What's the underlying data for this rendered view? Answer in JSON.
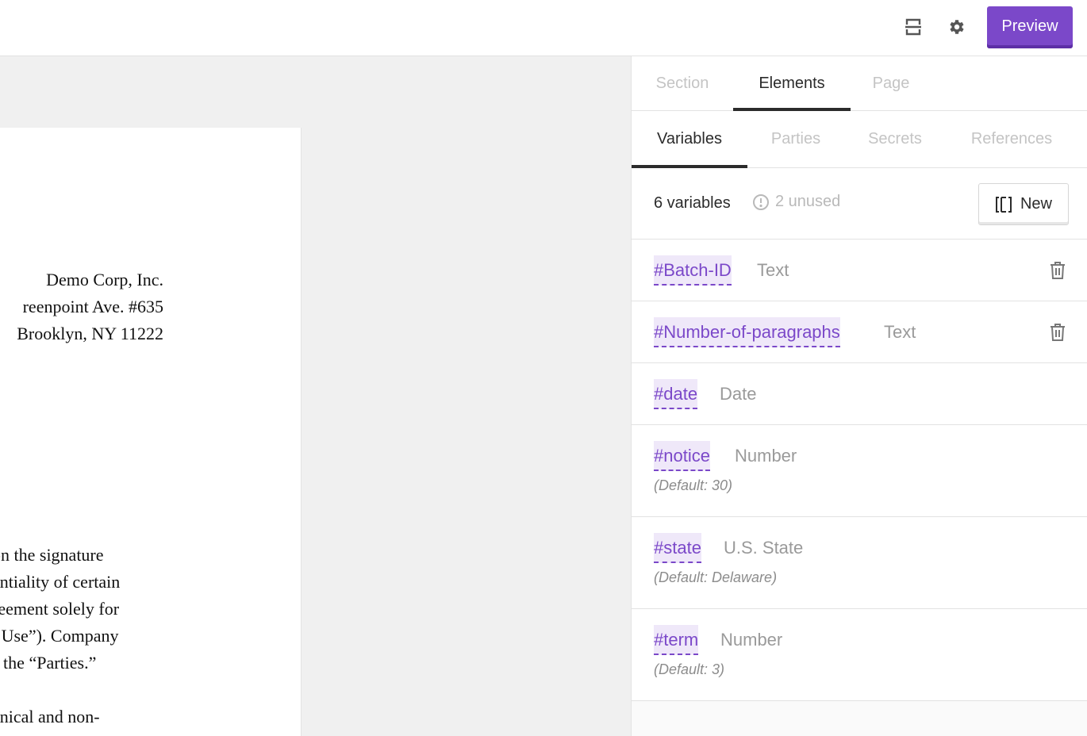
{
  "toolbar": {
    "print_icon": "page-break-icon",
    "settings_icon": "gear-icon",
    "preview_label": "Preview"
  },
  "document": {
    "address": [
      "Demo Corp, Inc.",
      "reenpoint Ave. #635",
      "Brooklyn, NY 11222"
    ],
    "body_lines": [
      " on the signature",
      "entiality of certain",
      "reement solely for",
      "l Use”). Company",
      "s the “Parties.”"
    ],
    "body_lines_2": [
      "anical and non-"
    ]
  },
  "panel": {
    "main_tabs": [
      {
        "label": "Section",
        "active": false
      },
      {
        "label": "Elements",
        "active": true
      },
      {
        "label": "Page",
        "active": false
      }
    ],
    "sub_tabs": [
      {
        "label": "Variables",
        "active": true
      },
      {
        "label": "Parties",
        "active": false
      },
      {
        "label": "Secrets",
        "active": false
      },
      {
        "label": "References",
        "active": false
      }
    ],
    "summary": {
      "count_label": "6 variables",
      "unused_label": "2 unused",
      "new_label": "New"
    },
    "variables": [
      {
        "name": "#Batch-ID",
        "type": "Text",
        "default": "",
        "deletable": true
      },
      {
        "name": "#Number-of-paragraphs",
        "type": "Text",
        "default": "",
        "deletable": true
      },
      {
        "name": "#date",
        "type": "Date",
        "default": "",
        "deletable": false
      },
      {
        "name": "#notice",
        "type": "Number",
        "default": "(Default: 30)",
        "deletable": false
      },
      {
        "name": "#state",
        "type": "U.S. State",
        "default": "(Default: Delaware)",
        "deletable": false
      },
      {
        "name": "#term",
        "type": "Number",
        "default": "(Default: 3)",
        "deletable": false
      }
    ]
  },
  "colors": {
    "accent": "#7b48c9",
    "accent_light": "#efe8f9",
    "muted": "#9a9a9a"
  }
}
